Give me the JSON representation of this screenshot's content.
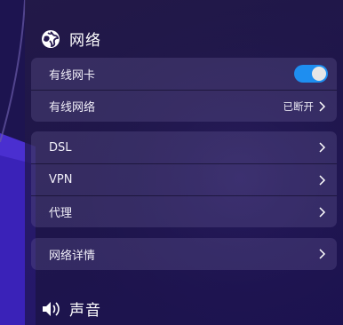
{
  "network": {
    "title": "网络",
    "icon": "network-globe-icon",
    "wired_card_label": "有线网卡",
    "wired_card_enabled": true,
    "wired_network_label": "有线网络",
    "wired_network_status": "已断开",
    "dsl_label": "DSL",
    "vpn_label": "VPN",
    "proxy_label": "代理",
    "details_label": "网络详情"
  },
  "sound": {
    "title": "声音",
    "icon": "speaker-icon"
  },
  "colors": {
    "accent": "#1e8ef0",
    "background": "#1a1248"
  }
}
